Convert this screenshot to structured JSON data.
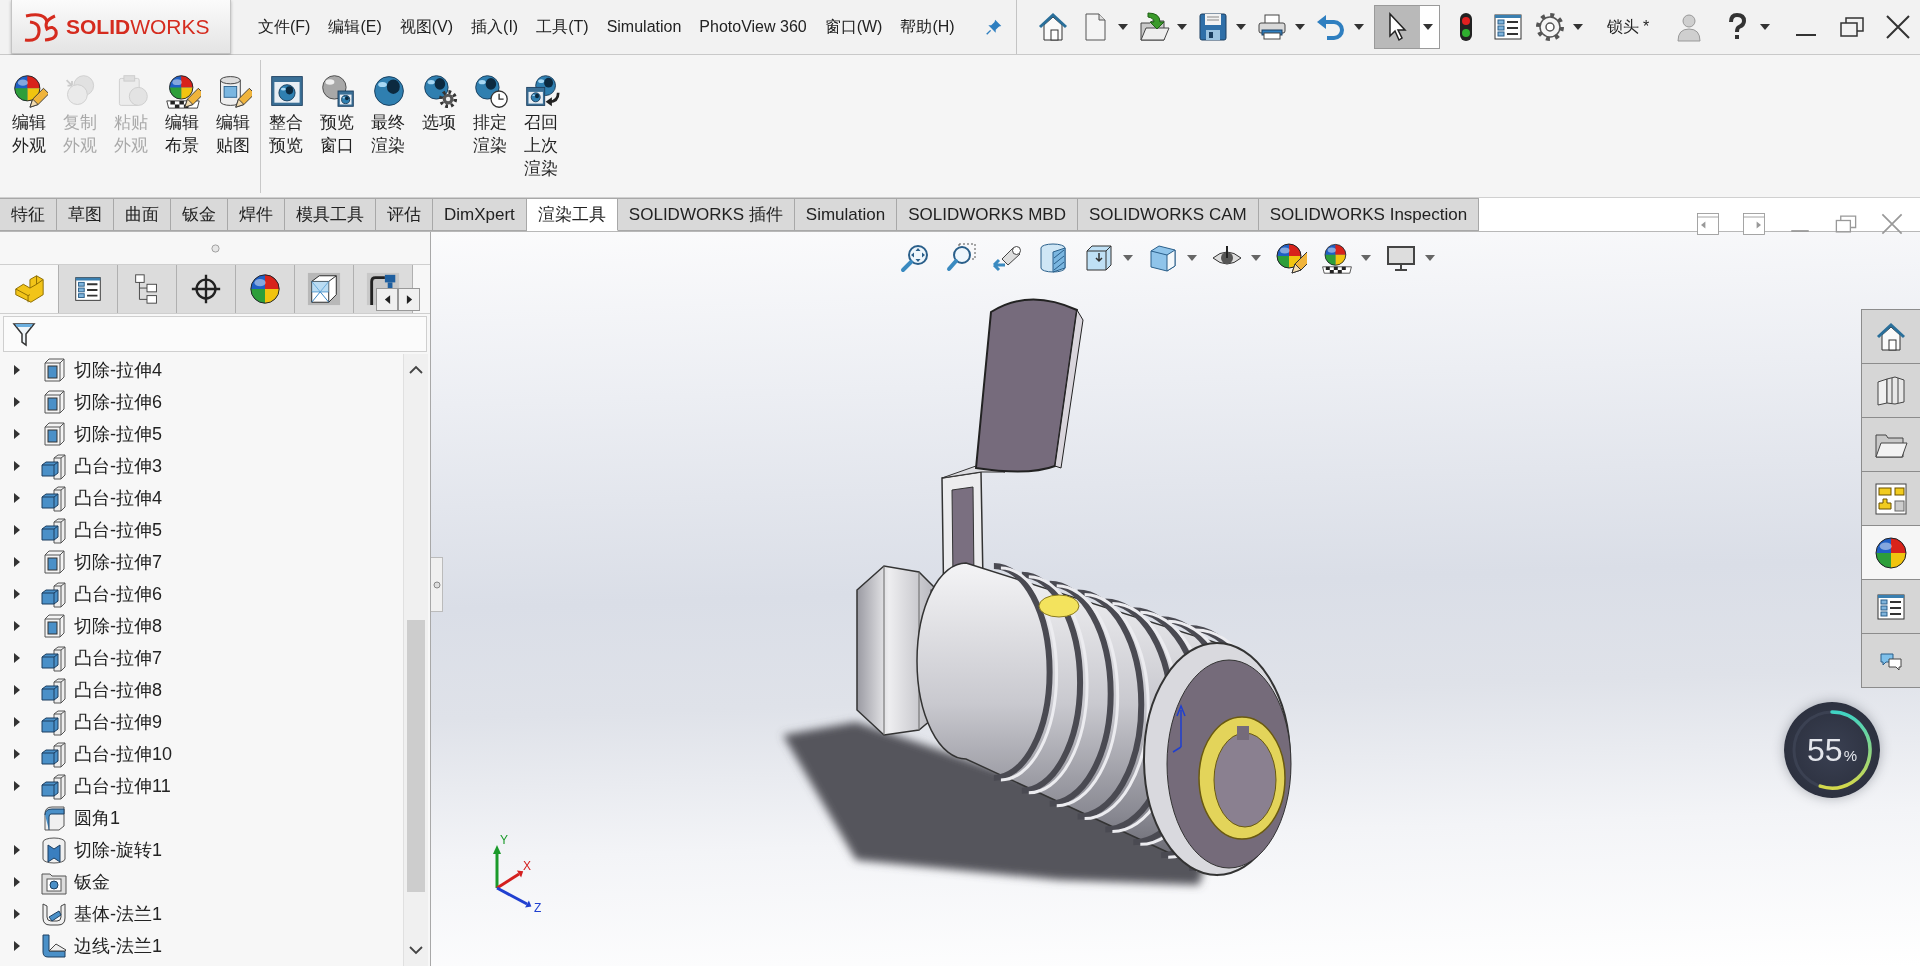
{
  "title_bar": {
    "logo": "**SOLID**WORKS",
    "menu": [
      "文件(F)",
      "编辑(E)",
      "视图(V)",
      "插入(I)",
      "工具(T)",
      "Simulation",
      "PhotoView 360",
      "窗口(W)",
      "帮助(H)"
    ],
    "select_tool_active": true,
    "document_name": "锁头 *"
  },
  "ribbon": {
    "groups": [
      {
        "buttons": [
          {
            "label": "编辑外观",
            "disabled": false
          },
          {
            "label": "复制外观",
            "disabled": true
          },
          {
            "label": "粘贴外观",
            "disabled": true
          },
          {
            "label": "编辑布景",
            "disabled": false
          },
          {
            "label": "编辑贴图",
            "disabled": false
          }
        ]
      },
      {
        "buttons": [
          {
            "label": "整合预览",
            "disabled": false
          },
          {
            "label": "预览窗口",
            "disabled": false
          },
          {
            "label": "最终渲染",
            "disabled": false
          },
          {
            "label": "选项",
            "disabled": false
          },
          {
            "label": "排定渲染",
            "disabled": false
          },
          {
            "label": "召回上次渲染",
            "disabled": false
          }
        ]
      }
    ]
  },
  "command_tabs": [
    {
      "label": "特征",
      "selected": false
    },
    {
      "label": "草图",
      "selected": false
    },
    {
      "label": "曲面",
      "selected": false
    },
    {
      "label": "钣金",
      "selected": false
    },
    {
      "label": "焊件",
      "selected": false
    },
    {
      "label": "模具工具",
      "selected": false
    },
    {
      "label": "评估",
      "selected": false
    },
    {
      "label": "DimXpert",
      "selected": false
    },
    {
      "label": "渲染工具",
      "selected": true
    },
    {
      "label": "SOLIDWORKS 插件",
      "selected": false
    },
    {
      "label": "Simulation",
      "selected": false
    },
    {
      "label": "SOLIDWORKS MBD",
      "selected": false
    },
    {
      "label": "SOLIDWORKS CAM",
      "selected": false
    },
    {
      "label": "SOLIDWORKS Inspection",
      "selected": false
    }
  ],
  "feature_manager": {
    "tabs": [
      {
        "selected": true
      },
      {
        "selected": false
      },
      {
        "selected": false
      },
      {
        "selected": false
      },
      {
        "selected": false
      },
      {
        "selected": false
      },
      {
        "selected": false
      }
    ],
    "tree": [
      {
        "label": "切除-拉伸4",
        "kind": "cut",
        "expandable": true,
        "expanded": false
      },
      {
        "label": "切除-拉伸6",
        "kind": "cut",
        "expandable": true,
        "expanded": false
      },
      {
        "label": "切除-拉伸5",
        "kind": "cut",
        "expandable": true,
        "expanded": false
      },
      {
        "label": "凸台-拉伸3",
        "kind": "boss",
        "expandable": true,
        "expanded": false
      },
      {
        "label": "凸台-拉伸4",
        "kind": "boss",
        "expandable": true,
        "expanded": false
      },
      {
        "label": "凸台-拉伸5",
        "kind": "boss",
        "expandable": true,
        "expanded": false
      },
      {
        "label": "切除-拉伸7",
        "kind": "cut",
        "expandable": true,
        "expanded": false
      },
      {
        "label": "凸台-拉伸6",
        "kind": "boss",
        "expandable": true,
        "expanded": false
      },
      {
        "label": "切除-拉伸8",
        "kind": "cut",
        "expandable": true,
        "expanded": false
      },
      {
        "label": "凸台-拉伸7",
        "kind": "boss",
        "expandable": true,
        "expanded": false
      },
      {
        "label": "凸台-拉伸8",
        "kind": "boss",
        "expandable": true,
        "expanded": false
      },
      {
        "label": "凸台-拉伸9",
        "kind": "boss",
        "expandable": true,
        "expanded": false
      },
      {
        "label": "凸台-拉伸10",
        "kind": "boss",
        "expandable": true,
        "expanded": false
      },
      {
        "label": "凸台-拉伸11",
        "kind": "boss",
        "expandable": true,
        "expanded": false
      },
      {
        "label": "圆角1",
        "kind": "fillet",
        "expandable": false
      },
      {
        "label": "切除-旋转1",
        "kind": "revolve",
        "expandable": true,
        "expanded": false
      },
      {
        "label": "钣金",
        "kind": "sheetmetal",
        "expandable": true,
        "expanded": false
      },
      {
        "label": "基体-法兰1",
        "kind": "baseflange",
        "expandable": true,
        "expanded": false
      },
      {
        "label": "边线-法兰1",
        "kind": "edgeflange",
        "expandable": true,
        "expanded": false
      }
    ]
  },
  "viewport": {
    "triad": {
      "x": "X",
      "y": "Y",
      "z": "Z"
    }
  },
  "task_pane": {
    "tabs": [
      {
        "selected": false
      },
      {
        "selected": false
      },
      {
        "selected": false
      },
      {
        "selected": false
      },
      {
        "selected": true
      },
      {
        "selected": false
      },
      {
        "selected": false
      }
    ]
  },
  "performance_meter": {
    "value": "55",
    "unit": "%",
    "level": 0.55
  }
}
